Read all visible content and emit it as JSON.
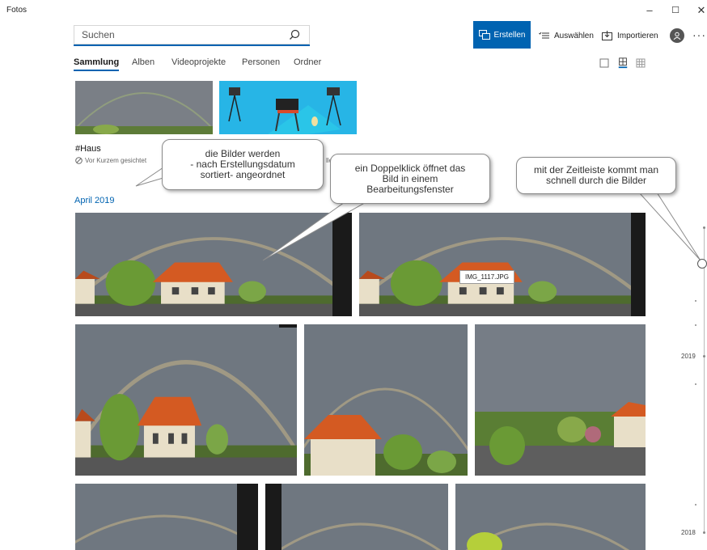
{
  "window": {
    "title": "Fotos",
    "minimize": "–",
    "maximize": "☐",
    "close": "✕"
  },
  "search": {
    "placeholder": "Suchen"
  },
  "toolbar": {
    "create_label": "Erstellen",
    "select_label": "Auswählen",
    "import_label": "Importieren",
    "more": "···"
  },
  "tabs": [
    "Sammlung",
    "Alben",
    "Videoprojekte",
    "Personen",
    "Ordner"
  ],
  "cards": [
    {
      "label": "#Haus",
      "sub": "Vor Kurzem gesichtet"
    },
    {
      "label": "",
      "sub": "ller"
    }
  ],
  "month": "April 2019",
  "tooltip": "IMG_1117.JPG",
  "callouts": {
    "sorting": [
      "die Bilder werden",
      "- nach Erstellungsdatum",
      "sortiert- angeordnet"
    ],
    "doubleclick": [
      "ein Doppelklick öffnet das",
      "Bild  in einem",
      "Bearbeitungsfenster"
    ],
    "timeline": [
      "mit der Zeitleiste kommt man",
      "schnell durch die Bilder"
    ]
  },
  "timeline": {
    "years": [
      "2019",
      "2018"
    ]
  },
  "colors": {
    "accent": "#0063b1",
    "sky": "#6f7780",
    "roof": "#d45a22",
    "wall": "#e8dfc8",
    "tree": "#6a9a35"
  }
}
